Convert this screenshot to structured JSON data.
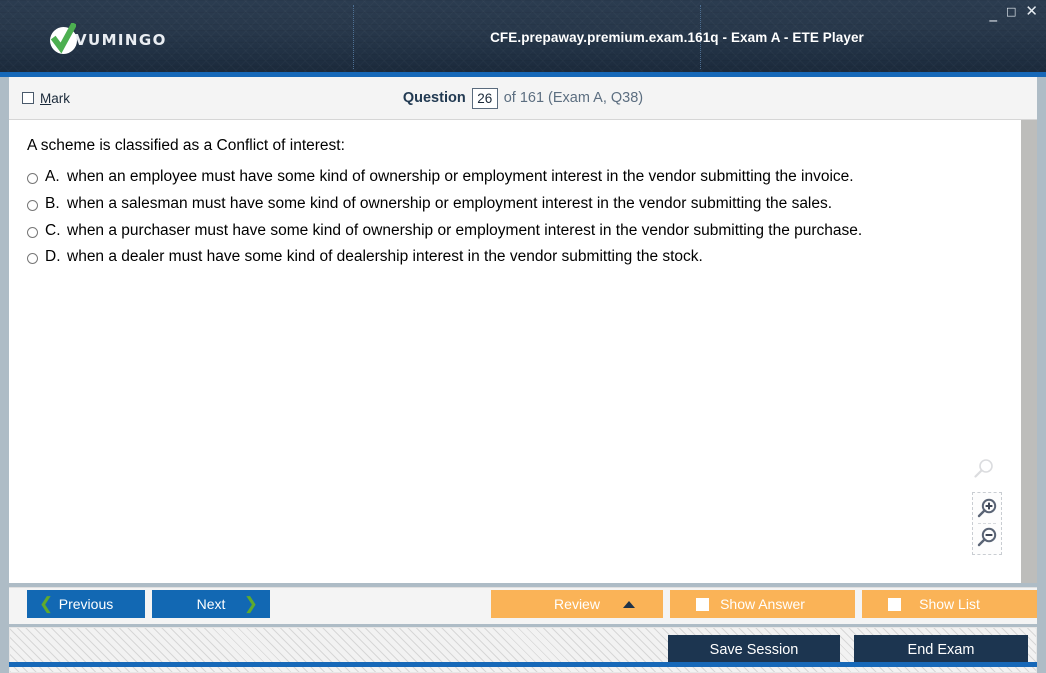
{
  "window": {
    "title": "CFE.prepaway.premium.exam.161q - Exam A - ETE Player",
    "brand": "Vumingo",
    "controls": {
      "minimize": "_",
      "maximize": "□",
      "close": "✕"
    }
  },
  "question_header": {
    "mark_label_pre": "",
    "mark_label": "Mark",
    "mark_accelerator": "M",
    "mark_rest": "ark",
    "mark_checked": false,
    "question_word": "Question",
    "current_number": "26",
    "rest": "of 161 (Exam A, Q38)",
    "total": "161",
    "exam": "Exam A",
    "source_ref": "Q38"
  },
  "question": {
    "stem": "A scheme is classified as a Conflict of interest:",
    "options": [
      {
        "letter": "A.",
        "text": "when an employee must have some kind of ownership or employment interest in the vendor submitting the invoice.",
        "selected": false
      },
      {
        "letter": "B.",
        "text": "when a salesman must have some kind of ownership or employment interest in the vendor submitting the sales.",
        "selected": false
      },
      {
        "letter": "C.",
        "text": "when a purchaser must have some kind of ownership or employment interest in the vendor submitting the purchase.",
        "selected": false
      },
      {
        "letter": "D.",
        "text": "when a dealer must have some kind of dealership interest in the vendor submitting the stock.",
        "selected": false
      }
    ]
  },
  "zoom_tools": {
    "reset_icon": "magnifier-icon",
    "zoom_in_icon": "zoom-in-icon",
    "zoom_out_icon": "zoom-out-icon"
  },
  "actions": {
    "previous": "Previous",
    "next": "Next",
    "review": "Review",
    "show_answer": "Show Answer",
    "show_list": "Show List",
    "save_session": "Save Session",
    "end_exam": "End Exam"
  },
  "colors": {
    "titlebar_dark": "#223245",
    "accent_blue": "#1668b8",
    "button_blue": "#1268b3",
    "orange": "#fab357",
    "dark_navy": "#1c3550",
    "green_check": "#4caf50",
    "green_chevron": "#5faa2e"
  }
}
